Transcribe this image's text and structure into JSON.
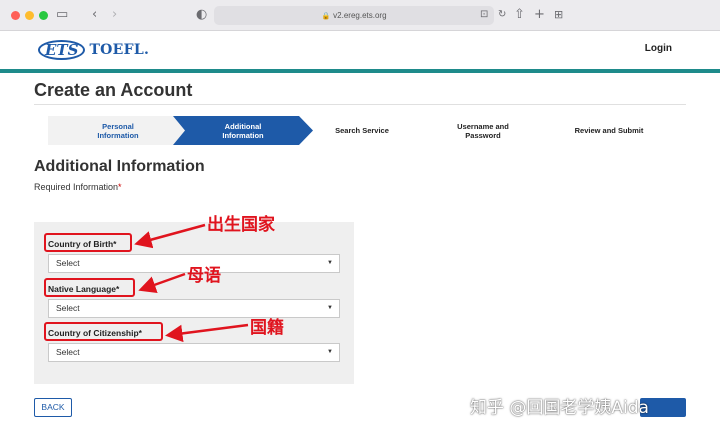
{
  "browser": {
    "url": "v2.ereg.ets.org"
  },
  "header": {
    "logo_ets": "ETS",
    "logo_toefl": "TOEFL.",
    "login_label": "Login"
  },
  "page": {
    "title": "Create an Account",
    "section_title": "Additional Information",
    "required_note": "Required Information",
    "required_star": "*"
  },
  "stepper": {
    "steps": [
      {
        "label_line1": "Personal",
        "label_line2": "Information",
        "state": "completed"
      },
      {
        "label_line1": "Additional",
        "label_line2": "Information",
        "state": "active"
      },
      {
        "label_line1": "Search Service",
        "label_line2": "",
        "state": "upcoming"
      },
      {
        "label_line1": "Username and",
        "label_line2": "Password",
        "state": "upcoming"
      },
      {
        "label_line1": "Review and Submit",
        "label_line2": "",
        "state": "upcoming"
      }
    ]
  },
  "form": {
    "fields": [
      {
        "label": "Country of Birth*",
        "value": "Select"
      },
      {
        "label": "Native Language*",
        "value": "Select"
      },
      {
        "label": "Country of Citizenship*",
        "value": "Select"
      }
    ]
  },
  "annotations": {
    "country_of_birth": "出生国家",
    "native_language": "母语",
    "citizenship": "国籍"
  },
  "buttons": {
    "back_label": "BACK"
  },
  "watermark": "知乎 @回国老学姨Aida",
  "colors": {
    "brand_blue": "#1e5aa8",
    "teal": "#1e8b8b",
    "annotation_red": "#e0141e"
  }
}
